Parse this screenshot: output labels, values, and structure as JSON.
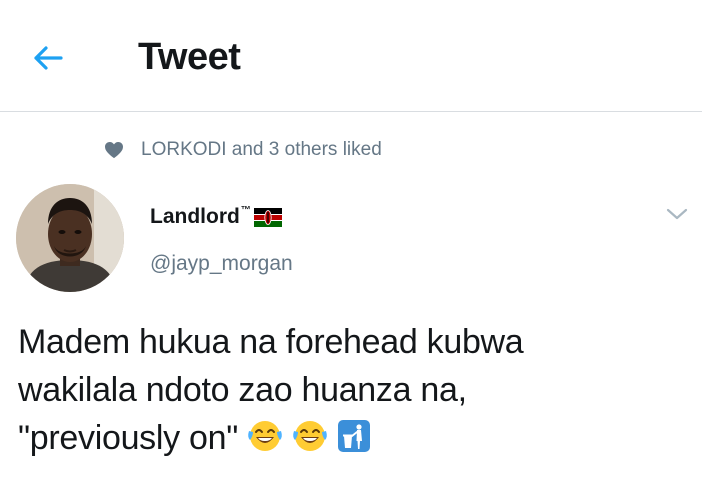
{
  "header": {
    "title": "Tweet",
    "back_icon": "arrow-left-icon",
    "accent_color": "#1da1f2"
  },
  "social_context": {
    "icon": "heart-icon",
    "text": "LORKODI and 3 others liked"
  },
  "author": {
    "display_name": "Landlord",
    "trademark": "™",
    "flag_icon": "kenya-flag-icon",
    "handle": "@jayp_morgan"
  },
  "menu": {
    "icon": "chevron-down-icon"
  },
  "tweet": {
    "lines": [
      "Madem hukua na forehead kubwa",
      "wakilala ndoto zao huanza na,",
      "\"previously on\""
    ],
    "emojis": [
      "face-with-tears-of-joy-icon",
      "face-with-tears-of-joy-icon",
      "put-litter-in-bin-icon"
    ]
  }
}
